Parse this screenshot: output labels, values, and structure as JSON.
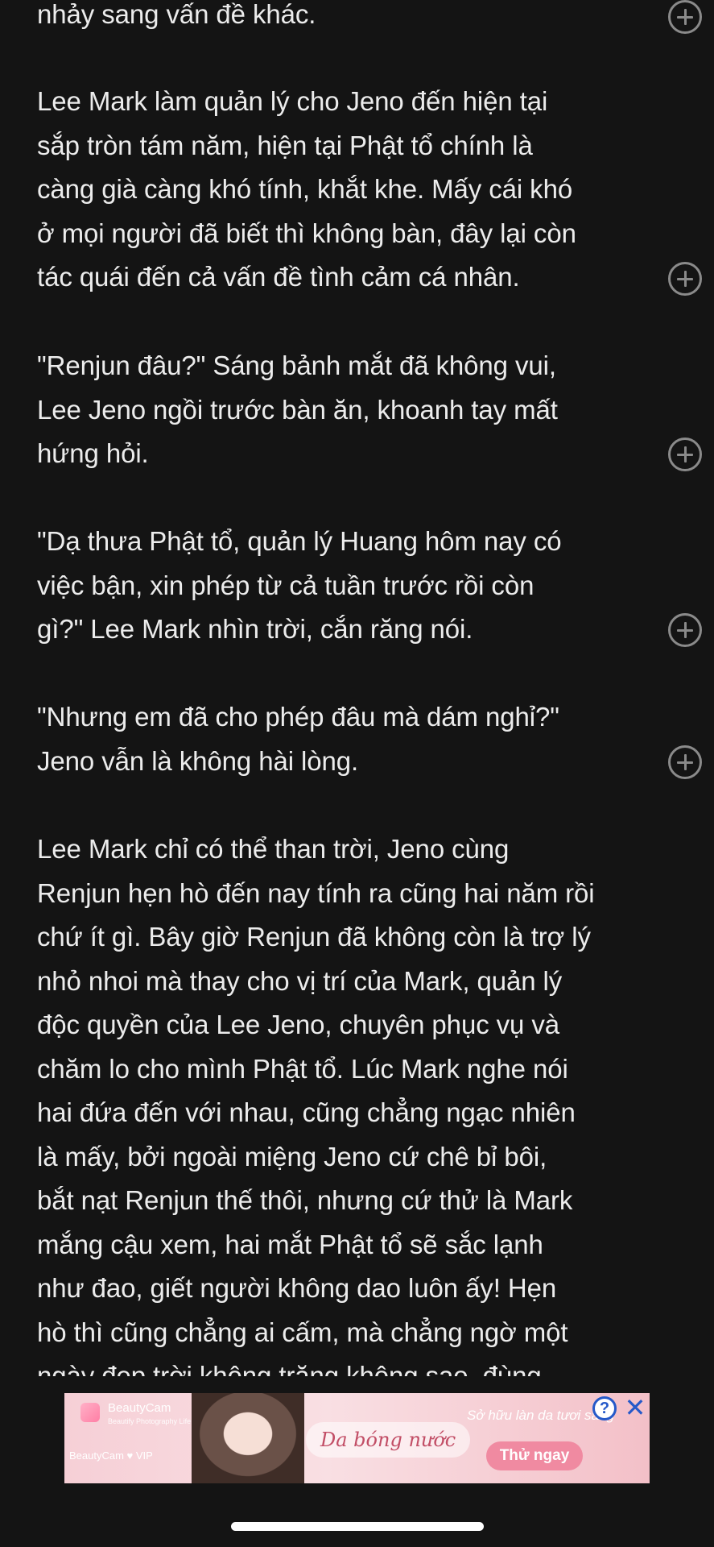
{
  "paragraphs": [
    {
      "lines": [
        "nhảy sang vấn đề khác."
      ]
    },
    {
      "lines": [
        "Lee Mark làm quản lý cho Jeno đến hiện tại",
        "sắp tròn tám năm, hiện tại Phật tổ chính là",
        "càng già càng khó tính, khắt khe. Mấy cái khó",
        "ở mọi người đã biết thì không bàn, đây lại còn",
        "tác quái đến cả vấn đề tình cảm cá nhân."
      ]
    },
    {
      "lines": [
        "\"Renjun đâu?\" Sáng bảnh mắt đã không vui,",
        "Lee Jeno ngồi trước bàn ăn, khoanh tay mất",
        "hứng hỏi."
      ]
    },
    {
      "lines": [
        "\"Dạ thưa Phật tổ, quản lý Huang hôm nay có",
        "việc bận, xin phép từ cả tuần trước rồi còn",
        "gì?\" Lee Mark nhìn trời, cắn răng nói."
      ]
    },
    {
      "lines": [
        "\"Nhưng em đã cho phép đâu mà dám nghỉ?\"",
        "Jeno vẫn là không hài lòng."
      ]
    },
    {
      "lines": [
        "Lee Mark chỉ có thể than trời, Jeno cùng",
        "Renjun hẹn hò đến nay tính ra cũng hai năm rồi",
        "chứ ít gì. Bây giờ Renjun đã không còn là trợ lý",
        "nhỏ nhoi mà thay cho vị trí của Mark, quản lý",
        "độc quyền của Lee Jeno, chuyên phục vụ và",
        "chăm lo cho mình Phật tổ. Lúc Mark nghe nói",
        "hai đứa đến với nhau, cũng chẳng ngạc nhiên",
        "là mấy, bởi ngoài miệng Jeno cứ chê bỉ bôi,",
        "bắt nạt Renjun thế thôi, nhưng cứ thử là Mark",
        "mắng cậu xem, hai mắt Phật tổ sẽ sắc lạnh",
        "như đao, giết người không dao luôn ấy! Hẹn",
        "hò thì cũng chẳng ai cấm, mà chẳng ngờ một",
        "ngày đẹp trời không trăng không sao, đùng"
      ]
    }
  ],
  "ad": {
    "brand": "BeautyCam",
    "brand_sub": "Beautify Photography Life",
    "tag": "BeautyCam ♥ VIP",
    "headline": "Da bóng nước",
    "right_text": "Sở hữu làn da tươi sáng",
    "cta": "Thử ngay",
    "info_icon": "?",
    "close_icon": "✕"
  }
}
